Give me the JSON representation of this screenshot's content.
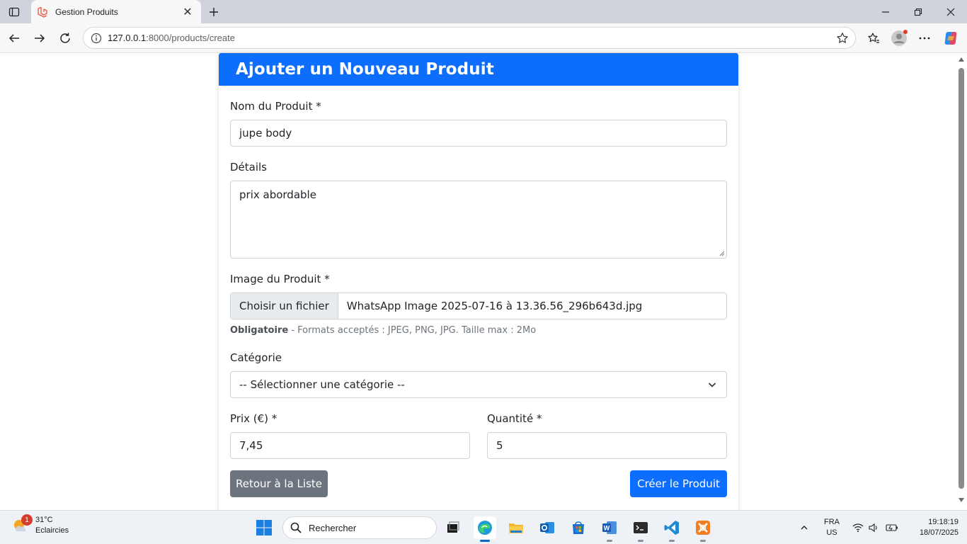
{
  "browser": {
    "tab_title": "Gestion Produits",
    "url_host": "127.0.0.1",
    "url_path": ":8000/products/create"
  },
  "form": {
    "header_title": "Ajouter un Nouveau Produit",
    "name_label": "Nom du Produit *",
    "name_value": "jupe body",
    "details_label": "Détails",
    "details_value": "prix abordable",
    "image_label": "Image du Produit *",
    "file_button_label": "Choisir un fichier",
    "file_name": "WhatsApp Image 2025-07-16 à 13.36.56_296b643d.jpg",
    "image_help_bold": "Obligatoire",
    "image_help_text": " - Formats acceptés : JPEG, PNG, JPG. Taille max : 2Mo",
    "category_label": "Catégorie",
    "category_selected": "-- Sélectionner une catégorie --",
    "price_label": "Prix (€) *",
    "price_value": "7,45",
    "quantity_label": "Quantité *",
    "quantity_value": "5",
    "back_button": "Retour à la Liste",
    "submit_button": "Créer le Produit"
  },
  "taskbar": {
    "weather_temp": "31°C",
    "weather_desc": "Eclaircies",
    "weather_badge": "1",
    "search_placeholder": "Rechercher",
    "lang_top": "FRA",
    "lang_bottom": "US",
    "time": "19:18:19",
    "date": "18/07/2025"
  },
  "colors": {
    "primary": "#0d6efd",
    "secondary": "#6c757d"
  }
}
